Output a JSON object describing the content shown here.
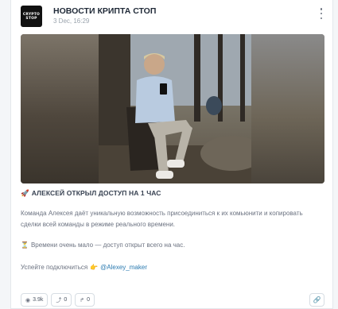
{
  "channel": {
    "avatar_line1": "CRYPTO",
    "avatar_line2": "STOP",
    "name": "НОВОСТИ КРИПТА СТОП",
    "date": "3 Dec, 16:29"
  },
  "post": {
    "title": "АЛЕКСЕЙ ОТКРЫЛ ДОСТУП НА 1 ЧАС",
    "title_icon": "🚀",
    "paragraph1": "Команда Алексея даёт уникальную возможность присоединиться к их комьюнити и копировать сделки всей команды в режиме реального времени.",
    "paragraph2_icon": "⏳",
    "paragraph2": "Времени очень мало — доступ открыт всего на час.",
    "paragraph3": "Успейте подключиться",
    "paragraph3_icon": "👉",
    "link_text": "@Alexey_maker"
  },
  "stats": {
    "views": "3.9k",
    "shares": "0",
    "reposts": "0"
  },
  "icons": {
    "views": "eye-icon",
    "shares": "share-icon",
    "reposts": "repost-icon",
    "link": "link-icon",
    "more": "kebab-menu-icon"
  }
}
